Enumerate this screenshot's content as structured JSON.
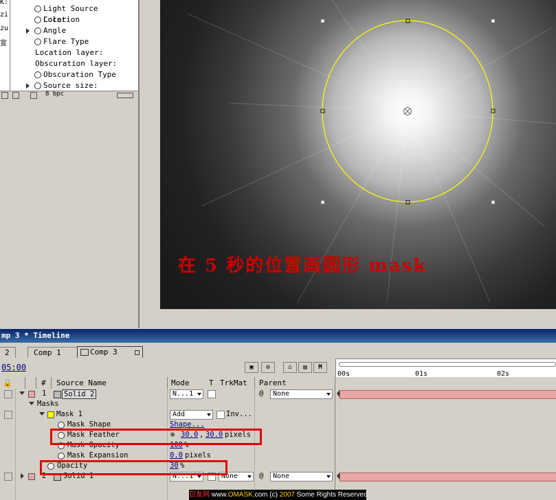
{
  "effects_panel": {
    "side_labels": [
      "K:",
      "zi",
      "zu",
      "宣"
    ],
    "properties": [
      {
        "label": "Light Source Location",
        "has_twirl": false
      },
      {
        "label": "Color",
        "has_twirl": false
      },
      {
        "label": "Angle",
        "has_twirl": true
      },
      {
        "label": "Flare Type",
        "has_twirl": false
      },
      {
        "label": "Location layer:",
        "has_twirl": false
      },
      {
        "label": "Obscuration layer:",
        "has_twirl": false
      },
      {
        "label": "Obscuration Type",
        "has_twirl": false
      },
      {
        "label": "Source size:",
        "has_twirl": true
      }
    ],
    "bottom_bar_text": "8 bpc"
  },
  "viewer": {
    "caption": "在 5 秒的位置画圆形 mask",
    "mask_color": "#ffff00",
    "caption_color": "#cc0000"
  },
  "timeline": {
    "title": "mp 3 * Timeline",
    "tabs": [
      "2",
      "Comp 1",
      "Comp 3"
    ],
    "active_tab": "Comp 3",
    "current_time": "05:00",
    "ruler_labels": [
      "00s",
      "01s",
      "02s"
    ],
    "headers": {
      "number": "#",
      "source_name": "Source Name",
      "mode": "Mode",
      "t": "T",
      "trkmat": "TrkMat",
      "parent": "Parent"
    },
    "layers": [
      {
        "number": "1",
        "name": "Solid 2",
        "mode": "N...1",
        "parent": "None",
        "color": "#e8a6a6"
      },
      {
        "number": "2",
        "name": "Solid 1",
        "mode": "N...1",
        "trkmat": "None",
        "parent": "None",
        "color": "#e8a6a6"
      }
    ],
    "masks_group": "Masks",
    "mask": {
      "name": "Mask 1",
      "mode": "Add",
      "inverted_label": "Inv..."
    },
    "mask_props": {
      "shape_label": "Mask Shape",
      "shape_value": "Shape...",
      "feather_label": "Mask Feather",
      "feather_x": "30.0",
      "feather_y": "30.0",
      "feather_unit": "pixels",
      "opacity_label": "Mask Opacity",
      "opacity_value": "100",
      "opacity_unit": "%",
      "expansion_label": "Mask Expansion",
      "expansion_value": "0.0",
      "expansion_unit": "pixels"
    },
    "layer_opacity": {
      "label": "Opacity",
      "value": "30",
      "unit": "%"
    }
  },
  "footer": {
    "site_cn": "ㄖ友网",
    "www": "www.",
    "domain": "OMASK",
    "rest": ".com (c) ",
    "year": "2007",
    "rights": " Some Rights Reserved"
  }
}
